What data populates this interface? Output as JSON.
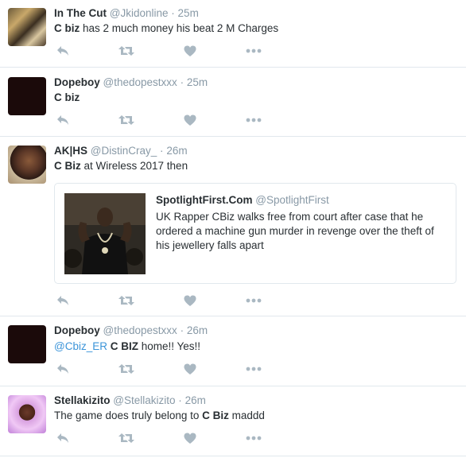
{
  "tweets": [
    {
      "name": "In The Cut",
      "handle": "@Jkidonline",
      "time": "25m",
      "text_bold": "C biz",
      "text_rest": " has 2 much money his beat 2 M Charges"
    },
    {
      "name": "Dopeboy",
      "handle": "@thedopestxxx",
      "time": "25m",
      "text_bold": "C biz",
      "text_rest": ""
    },
    {
      "name": "AK|HS",
      "handle": "@DistinCray_",
      "time": "26m",
      "text_bold": "C Biz",
      "text_rest": " at Wireless 2017 then",
      "card": {
        "source_name": "SpotlightFirst.Com",
        "source_handle": "@SpotlightFirst",
        "description": "UK Rapper CBiz walks free from court after case that he ordered a machine gun murder in revenge over the theft of his jewellery falls apart"
      }
    },
    {
      "name": "Dopeboy",
      "handle": "@thedopestxxx",
      "time": "26m",
      "mention": "@Cbiz_ER",
      "text_bold": "C BIZ",
      "text_rest": " home!! Yes!!"
    },
    {
      "name": "Stellakizito",
      "handle": "@Stellakizito",
      "time": "26m",
      "text_pre": "The game does truly belong to ",
      "text_bold": "C Biz",
      "text_rest": " maddd"
    }
  ],
  "icons": {
    "reply": "reply-icon",
    "retweet": "retweet-icon",
    "like": "heart-icon",
    "more": "more-icon"
  },
  "colors": {
    "meta": "#8899a6",
    "mention": "#3b94d9",
    "icon": "#aab8c2",
    "divider": "#e1e8ed"
  }
}
